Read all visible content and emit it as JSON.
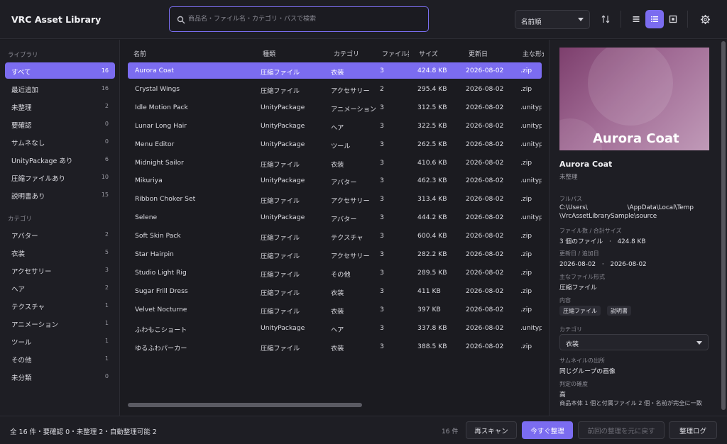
{
  "app": {
    "title": "VRC Asset Library"
  },
  "search": {
    "placeholder": "商品名・ファイル名・カテゴリ・パスで検索",
    "value": ""
  },
  "toolbar": {
    "sort_label": "名前順",
    "view_active": "list-compact"
  },
  "sidebar": {
    "library_title": "ライブラリ",
    "library_items": [
      {
        "label": "すべて",
        "count": "16",
        "active": true
      },
      {
        "label": "最近追加",
        "count": "16"
      },
      {
        "label": "未整理",
        "count": "2"
      },
      {
        "label": "要確認",
        "count": "0"
      },
      {
        "label": "サムネなし",
        "count": "0"
      },
      {
        "label": "UnityPackage あり",
        "count": "6"
      },
      {
        "label": "圧縮ファイルあり",
        "count": "10"
      },
      {
        "label": "説明書あり",
        "count": "15"
      }
    ],
    "category_title": "カテゴリ",
    "category_items": [
      {
        "label": "アバター",
        "count": "2"
      },
      {
        "label": "衣装",
        "count": "5"
      },
      {
        "label": "アクセサリー",
        "count": "3"
      },
      {
        "label": "ヘア",
        "count": "2"
      },
      {
        "label": "テクスチャ",
        "count": "1"
      },
      {
        "label": "アニメーション",
        "count": "1"
      },
      {
        "label": "ツール",
        "count": "1"
      },
      {
        "label": "その他",
        "count": "1"
      },
      {
        "label": "未分類",
        "count": "0"
      }
    ]
  },
  "table": {
    "headers": {
      "name": "名前",
      "type": "種類",
      "category": "カテゴリ",
      "files": "ファイル数",
      "size": "サイズ",
      "updated": "更新日",
      "format": "主な形式"
    },
    "rows": [
      {
        "name": "Aurora Coat",
        "type": "圧縮ファイル",
        "category": "衣装",
        "files": "3",
        "size": "424.8 KB",
        "updated": "2026-08-02",
        "format": ".zip",
        "selected": true
      },
      {
        "name": "Crystal Wings",
        "type": "圧縮ファイル",
        "category": "アクセサリー",
        "files": "2",
        "size": "295.4 KB",
        "updated": "2026-08-02",
        "format": ".zip"
      },
      {
        "name": "Idle Motion Pack",
        "type": "UnityPackage",
        "category": "アニメーション",
        "files": "3",
        "size": "312.5 KB",
        "updated": "2026-08-02",
        "format": ".unitypackage"
      },
      {
        "name": "Lunar Long Hair",
        "type": "UnityPackage",
        "category": "ヘア",
        "files": "3",
        "size": "322.5 KB",
        "updated": "2026-08-02",
        "format": ".unitypackage"
      },
      {
        "name": "Menu Editor",
        "type": "UnityPackage",
        "category": "ツール",
        "files": "3",
        "size": "262.5 KB",
        "updated": "2026-08-02",
        "format": ".unitypackage"
      },
      {
        "name": "Midnight Sailor",
        "type": "圧縮ファイル",
        "category": "衣装",
        "files": "3",
        "size": "410.6 KB",
        "updated": "2026-08-02",
        "format": ".zip"
      },
      {
        "name": "Mikuriya",
        "type": "UnityPackage",
        "category": "アバター",
        "files": "3",
        "size": "462.3 KB",
        "updated": "2026-08-02",
        "format": ".unitypackage"
      },
      {
        "name": "Ribbon Choker Set",
        "type": "圧縮ファイル",
        "category": "アクセサリー",
        "files": "3",
        "size": "313.4 KB",
        "updated": "2026-08-02",
        "format": ".zip"
      },
      {
        "name": "Selene",
        "type": "UnityPackage",
        "category": "アバター",
        "files": "3",
        "size": "444.2 KB",
        "updated": "2026-08-02",
        "format": ".unitypackage"
      },
      {
        "name": "Soft Skin Pack",
        "type": "圧縮ファイル",
        "category": "テクスチャ",
        "files": "3",
        "size": "600.4 KB",
        "updated": "2026-08-02",
        "format": ".zip"
      },
      {
        "name": "Star Hairpin",
        "type": "圧縮ファイル",
        "category": "アクセサリー",
        "files": "3",
        "size": "282.2 KB",
        "updated": "2026-08-02",
        "format": ".zip"
      },
      {
        "name": "Studio Light Rig",
        "type": "圧縮ファイル",
        "category": "その他",
        "files": "3",
        "size": "289.5 KB",
        "updated": "2026-08-02",
        "format": ".zip"
      },
      {
        "name": "Sugar Frill Dress",
        "type": "圧縮ファイル",
        "category": "衣装",
        "files": "3",
        "size": "411 KB",
        "updated": "2026-08-02",
        "format": ".zip"
      },
      {
        "name": "Velvet Nocturne",
        "type": "圧縮ファイル",
        "category": "衣装",
        "files": "3",
        "size": "397 KB",
        "updated": "2026-08-02",
        "format": ".zip"
      },
      {
        "name": "ふわもこショート",
        "type": "UnityPackage",
        "category": "ヘア",
        "files": "3",
        "size": "337.8 KB",
        "updated": "2026-08-02",
        "format": ".unitypackage"
      },
      {
        "name": "ゆるふわパーカー",
        "type": "圧縮ファイル",
        "category": "衣装",
        "files": "3",
        "size": "388.5 KB",
        "updated": "2026-08-02",
        "format": ".zip"
      }
    ]
  },
  "detail": {
    "thumb_text": "Aurora Coat",
    "title": "Aurora Coat",
    "status": "未整理",
    "path_label": "フルパス",
    "path_line1": "C:\\Users\\                    \\AppData\\Local\\Temp",
    "path_line2": "\\VrcAssetLibrarySample\\source",
    "files_label": "ファイル数 / 合計サイズ",
    "files_value": "3 個のファイル　·　424.8 KB",
    "dates_label": "更新日 / 追加日",
    "dates_value": "2026-08-02　·　2026-08-02",
    "format_label": "主なファイル形式",
    "format_value": "圧縮ファイル",
    "contents_label": "内容",
    "contents_chips": [
      "圧縮ファイル",
      "説明書"
    ],
    "category_label": "カテゴリ",
    "category_value": "衣装",
    "thumb_source_label": "サムネイルの出所",
    "thumb_source_value": "同じグループの画像",
    "confidence_label": "判定の確度",
    "confidence_value": "高",
    "reason": "商品本体 1 個と付属ファイル 2 個・名前が完全に一致"
  },
  "footer": {
    "status": "全 16 件・要確認 0・未整理 2・自動整理可能 2",
    "count": "16 件",
    "rescan": "再スキャン",
    "organize_now": "今すぐ整理",
    "undo": "前回の整理を元に戻す",
    "log": "整理ログ"
  },
  "colors": {
    "accent": "#7b6cf0",
    "background": "#1b1b20",
    "panel": "#1e1e24"
  }
}
